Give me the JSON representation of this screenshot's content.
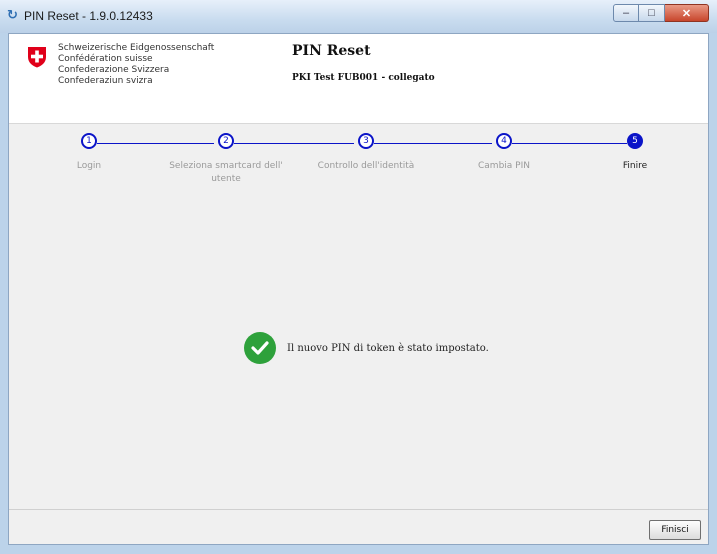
{
  "window": {
    "title": "PIN Reset - 1.9.0.12433",
    "minimize_label": "–",
    "maximize_label": "□",
    "close_label": "✕"
  },
  "header": {
    "federation_lines": [
      "Schweizerische Eidgenossenschaft",
      "Confédération suisse",
      "Confederazione Svizzera",
      "Confederaziun svizra"
    ],
    "app_title": "PIN Reset",
    "connection_status": "PKI Test FUB001 - collegato"
  },
  "steps": [
    {
      "number": "1",
      "label": "Login",
      "current": false
    },
    {
      "number": "2",
      "label": "Seleziona smartcard dell' utente",
      "current": false
    },
    {
      "number": "3",
      "label": "Controllo dell'identità",
      "current": false
    },
    {
      "number": "4",
      "label": "Cambia PIN",
      "current": false
    },
    {
      "number": "5",
      "label": "Finire",
      "current": true
    }
  ],
  "status": {
    "message": "Il nuovo PIN di token è stato impostato.",
    "icon": "check-circle-icon",
    "icon_color": "#2ea13b"
  },
  "footer": {
    "finish_label": "Finisci"
  },
  "colors": {
    "step_accent": "#0b14c8",
    "titlebar": "#c9dcef"
  }
}
